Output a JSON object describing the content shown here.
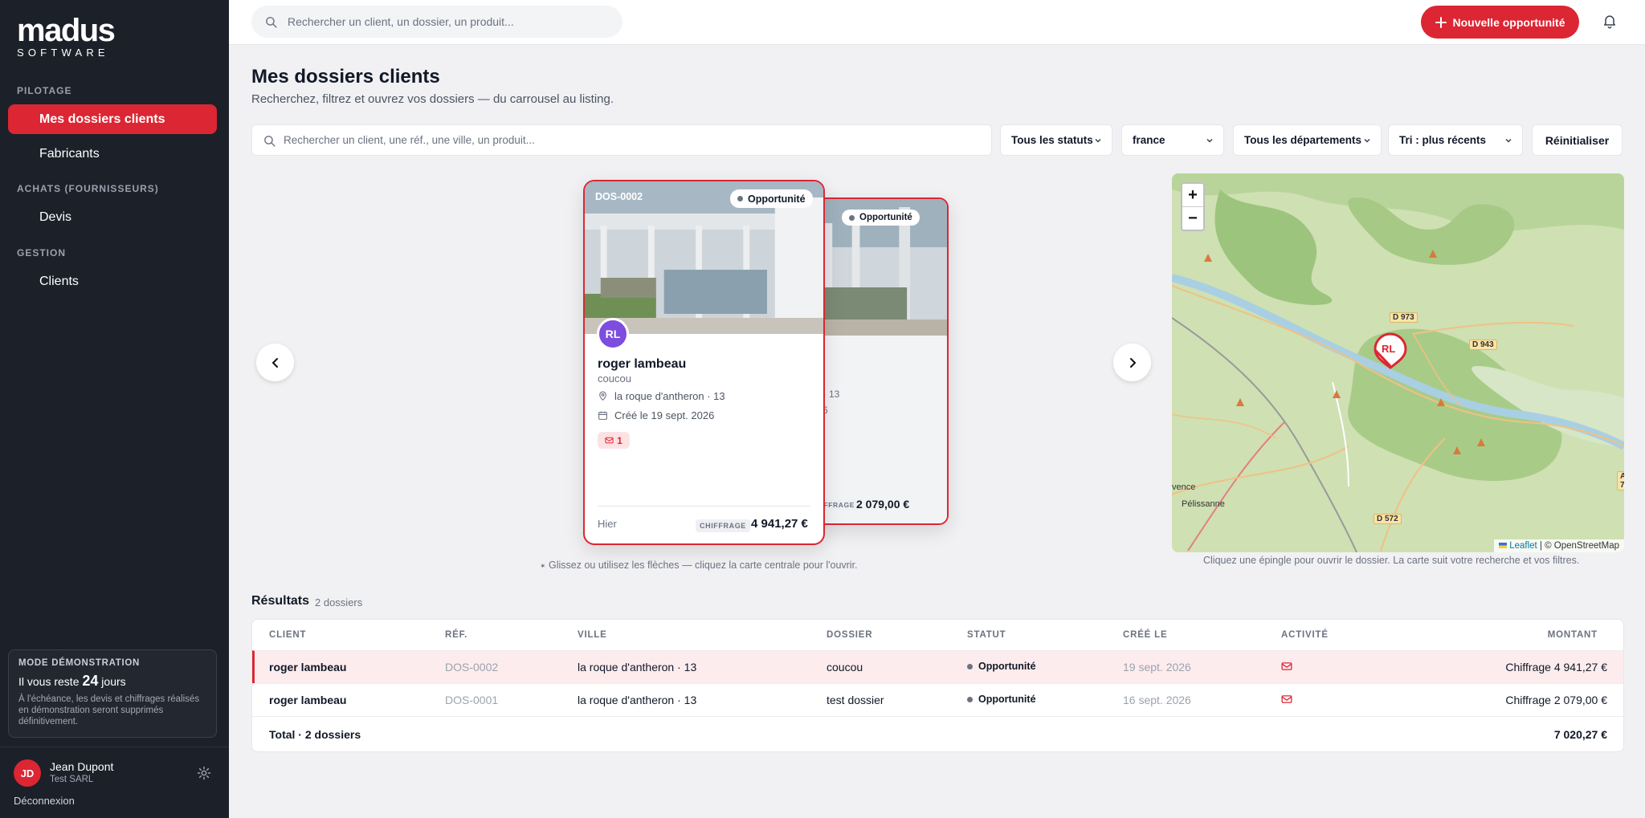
{
  "app": {
    "logo_main": "madus",
    "logo_sub": "SOFTWARE"
  },
  "sidebar": {
    "sections": [
      {
        "label": "PILOTAGE",
        "items": [
          {
            "label": "Mes dossiers clients",
            "active": true
          },
          {
            "label": "Fabricants"
          }
        ]
      },
      {
        "label": "ACHATS (FOURNISSEURS)",
        "items": [
          {
            "label": "Devis"
          }
        ]
      },
      {
        "label": "GESTION",
        "items": [
          {
            "label": "Clients"
          }
        ]
      }
    ],
    "demo": {
      "title": "MODE DÉMONSTRATION",
      "days_prefix": "Il vous reste",
      "days": "24",
      "days_suffix": "jours",
      "note": "À l'échéance, les devis et chiffrages réalisés en démonstration seront supprimés définitivement."
    },
    "user": {
      "initials": "JD",
      "name": "Jean Dupont",
      "company": "Test SARL"
    },
    "logout_label": "Déconnexion"
  },
  "topbar": {
    "search_placeholder": "Rechercher un client, un dossier, un produit...",
    "new_button_label": "Nouvelle opportunité"
  },
  "page": {
    "title": "Mes dossiers clients",
    "subtitle": "Recherchez, filtrez et ouvrez vos dossiers — du carrousel au listing."
  },
  "filters": {
    "search_placeholder": "Rechercher un client, une réf., une ville, un produit...",
    "status": "Tous les statuts",
    "country": "france",
    "department": "Tous les départements",
    "sort": "Tri : plus récents",
    "reset_label": "Réinitialiser"
  },
  "carousel": {
    "main_card": {
      "ref": "DOS-0002",
      "status": "Opportunité",
      "initials": "RL",
      "client": "roger lambeau",
      "dossier": "coucou",
      "location": "la roque d'antheron · 13",
      "created": "Créé le 19 sept. 2026",
      "mail_count": "1",
      "date": "Hier",
      "amount_tag": "CHIFFRAGE",
      "amount": "4 941,27 €"
    },
    "side_card": {
      "status": "Opportunité",
      "location_partial": "ron · 13",
      "created_partial": "2026",
      "amount_tag": "CHIFFRAGE",
      "amount": "2 079,00 €"
    },
    "hint": "Glissez ou utilisez les flèches — cliquez la carte centrale pour l'ouvrir."
  },
  "map": {
    "zoom_in": "+",
    "zoom_out": "−",
    "marker_label": "RL",
    "roads": [
      "D 973",
      "D 943",
      "D 572",
      "A 7"
    ],
    "places": [
      "vence",
      "Pélissanne"
    ],
    "attribution_link": "Leaflet",
    "attribution_rest": "| © OpenStreetMap",
    "hint": "Cliquez une épingle pour ouvrir le dossier. La carte suit votre recherche et vos filtres."
  },
  "results": {
    "title": "Résultats",
    "count": "2 dossiers",
    "columns": [
      "CLIENT",
      "RÉF.",
      "VILLE",
      "DOSSIER",
      "STATUT",
      "CRÉÉ LE",
      "ACTIVITÉ",
      "MONTANT"
    ],
    "rows": [
      {
        "client": "roger lambeau",
        "ref": "DOS-0002",
        "city": "la roque d'antheron · 13",
        "dossier": "coucou",
        "status": "Opportunité",
        "created": "19 sept. 2026",
        "amount": "Chiffrage 4 941,27 €",
        "selected": true
      },
      {
        "client": "roger lambeau",
        "ref": "DOS-0001",
        "city": "la roque d'antheron · 13",
        "dossier": "test dossier",
        "status": "Opportunité",
        "created": "16 sept. 2026",
        "amount": "Chiffrage 2 079,00 €",
        "selected": false
      }
    ],
    "total_label": "Total · 2 dossiers",
    "total_amount": "7 020,27 €"
  },
  "colors": {
    "accent": "#dc2633",
    "sidebar": "#1c2029",
    "avatar": "#7c4ddf"
  }
}
